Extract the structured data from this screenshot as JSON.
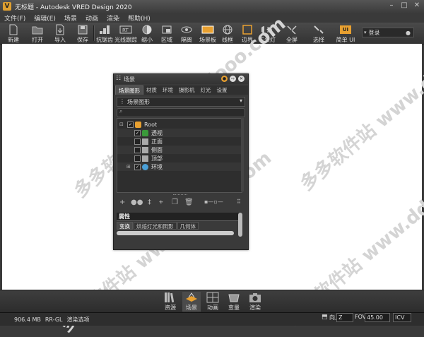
{
  "window": {
    "title": "无标题 - Autodesk VRED Design 2020",
    "logo_letter": "V"
  },
  "menu": [
    "文件(F)",
    "编辑(E)",
    "场景",
    "动画",
    "渲染",
    "帮助(H)"
  ],
  "toolbar": [
    {
      "label": "新建",
      "icon": "new-file-icon"
    },
    {
      "label": "打开",
      "icon": "folder-icon"
    },
    {
      "label": "导入",
      "icon": "import-icon"
    },
    {
      "label": "保存",
      "icon": "save-icon"
    },
    {
      "label": "抗锯齿",
      "icon": "antialias-icon"
    },
    {
      "label": "光线跟踪",
      "icon": "raytracing-icon"
    },
    {
      "label": "缩小",
      "icon": "zoom-out-icon"
    },
    {
      "label": "区域",
      "icon": "region-icon"
    },
    {
      "label": "隔离",
      "icon": "isolate-icon"
    },
    {
      "label": "场景板",
      "icon": "sceneplate-icon"
    },
    {
      "label": "线框",
      "icon": "wireframe-icon"
    },
    {
      "label": "边界",
      "icon": "bounds-icon"
    },
    {
      "label": "车头灯",
      "icon": "headlight-icon"
    },
    {
      "label": "全屏",
      "icon": "fullscreen-icon"
    },
    {
      "label": "选择",
      "icon": "select-icon"
    },
    {
      "label": "简单 UI",
      "icon": "simple-ui-icon",
      "badge": "UI"
    }
  ],
  "login": {
    "label": "登录"
  },
  "watermark": "多多软件站  www.ddooo.com",
  "scene_panel": {
    "title": "场景",
    "tabs": [
      "场景图形",
      "材质",
      "环境",
      "摄影机",
      "灯光",
      "设置"
    ],
    "view_select": "场景图形",
    "tree": [
      {
        "label": "Root",
        "level": 0,
        "icon": "root-icon"
      },
      {
        "label": "透视",
        "level": 1,
        "icon": "camera-icon"
      },
      {
        "label": "正面",
        "level": 1,
        "icon": "camera-icon"
      },
      {
        "label": "侧面",
        "level": 1,
        "icon": "camera-icon"
      },
      {
        "label": "顶部",
        "level": 1,
        "icon": "camera-icon"
      },
      {
        "label": "环境",
        "level": 1,
        "icon": "environment-icon"
      }
    ],
    "attr_title": "属性",
    "attr_tabs": [
      "变换",
      "烘焙灯光和阴影",
      "几何体"
    ]
  },
  "dock": [
    {
      "label": "资源",
      "icon": "assets-icon"
    },
    {
      "label": "场景",
      "icon": "scene-icon"
    },
    {
      "label": "动画",
      "icon": "animation-icon"
    },
    {
      "label": "变量",
      "icon": "variants-icon"
    },
    {
      "label": "渲染",
      "icon": "render-icon"
    }
  ],
  "status": {
    "memory": "906.4 MB",
    "renderer": "RR-GL",
    "render_options": "渲染选项",
    "up_label": "向上",
    "up_axis": "Z",
    "fov_label": "FOV",
    "fov_value": "45.00",
    "mode": "ICV"
  },
  "colors": {
    "accent": "#e8a030",
    "viewport": "#ffffff",
    "ui_bg": "#3a3a3a"
  }
}
